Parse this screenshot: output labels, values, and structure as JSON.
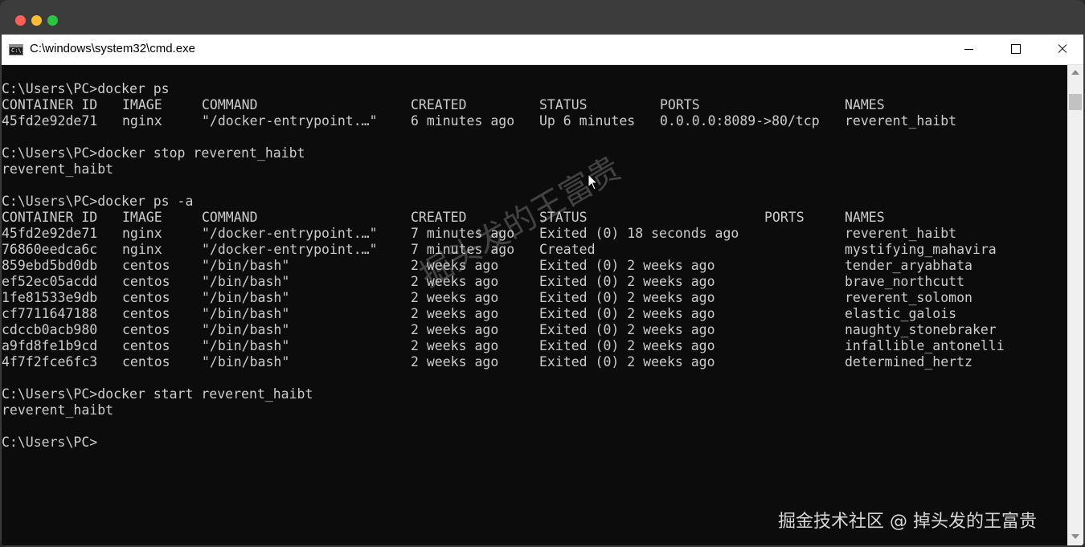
{
  "window": {
    "title": "C:\\windows\\system32\\cmd.exe",
    "icon": "cmd-icon",
    "icon_text": "C:\\."
  },
  "console": {
    "lines": [
      {
        "text": "C:\\Users\\PC>docker ps"
      },
      {
        "cols": [
          "CONTAINER ID",
          "IMAGE",
          "COMMAND",
          "CREATED",
          "STATUS",
          "PORTS",
          "NAMES"
        ]
      },
      {
        "cols": [
          "45fd2e92de71",
          "nginx",
          "\"/docker-entrypoint.…\"",
          "6 minutes ago",
          "Up 6 minutes",
          "0.0.0.0:8089->80/tcp",
          "reverent_haibt"
        ]
      },
      {
        "text": ""
      },
      {
        "text": "C:\\Users\\PC>docker stop reverent_haibt"
      },
      {
        "text": "reverent_haibt"
      },
      {
        "text": ""
      },
      {
        "text": "C:\\Users\\PC>docker ps -a"
      },
      {
        "cols": [
          "CONTAINER ID",
          "IMAGE",
          "COMMAND",
          "CREATED",
          "STATUS",
          "PORTS",
          "NAMES"
        ]
      },
      {
        "cols": [
          "45fd2e92de71",
          "nginx",
          "\"/docker-entrypoint.…\"",
          "7 minutes ago",
          "Exited (0) 18 seconds ago",
          "",
          "reverent_haibt"
        ]
      },
      {
        "cols": [
          "76860eedca6c",
          "nginx",
          "\"/docker-entrypoint.…\"",
          "7 minutes ago",
          "Created",
          "",
          "mystifying_mahavira"
        ]
      },
      {
        "cols": [
          "859ebd5bd0db",
          "centos",
          "\"/bin/bash\"",
          "2 weeks ago",
          "Exited (0) 2 weeks ago",
          "",
          "tender_aryabhata"
        ]
      },
      {
        "cols": [
          "ef52ec05acdd",
          "centos",
          "\"/bin/bash\"",
          "2 weeks ago",
          "Exited (0) 2 weeks ago",
          "",
          "brave_northcutt"
        ]
      },
      {
        "cols": [
          "1fe81533e9db",
          "centos",
          "\"/bin/bash\"",
          "2 weeks ago",
          "Exited (0) 2 weeks ago",
          "",
          "reverent_solomon"
        ]
      },
      {
        "cols": [
          "cf7711647188",
          "centos",
          "\"/bin/bash\"",
          "2 weeks ago",
          "Exited (0) 2 weeks ago",
          "",
          "elastic_galois"
        ]
      },
      {
        "cols": [
          "cdccb0acb980",
          "centos",
          "\"/bin/bash\"",
          "2 weeks ago",
          "Exited (0) 2 weeks ago",
          "",
          "naughty_stonebraker"
        ]
      },
      {
        "cols": [
          "a9fd8fe1b9cd",
          "centos",
          "\"/bin/bash\"",
          "2 weeks ago",
          "Exited (0) 2 weeks ago",
          "",
          "infallible_antonelli"
        ]
      },
      {
        "cols": [
          "4f7f2fce6fc3",
          "centos",
          "\"/bin/bash\"",
          "2 weeks ago",
          "Exited (0) 2 weeks ago",
          "",
          "determined_hertz"
        ]
      },
      {
        "text": ""
      },
      {
        "text": "C:\\Users\\PC>docker start reverent_haibt"
      },
      {
        "text": "reverent_haibt"
      },
      {
        "text": ""
      },
      {
        "text": "C:\\Users\\PC>"
      }
    ]
  },
  "watermark": {
    "diagonal": "掘头发的王富贵",
    "corner": "掘金技术社区 @ 掉头发的王富贵"
  },
  "colors": {
    "console_bg": "#0c0c0c",
    "console_fg": "#cccccc",
    "title_bar": "#ffffff",
    "mac_close": "#ff5f57",
    "mac_minimize": "#febc2e",
    "mac_zoom": "#28c840"
  }
}
